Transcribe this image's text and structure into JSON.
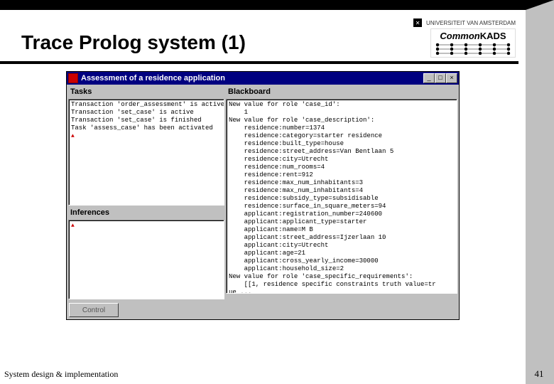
{
  "slide": {
    "title": "Trace Prolog system (1)",
    "footer": "System design & implementation",
    "page_number": "41",
    "inst_logo_text": "UNIVERSITEIT VAN AMSTERDAM",
    "ck_logo_text_1": "Common",
    "ck_logo_text_2": "KADS"
  },
  "window": {
    "title": "Assessment of a residence application",
    "buttons": {
      "min": "_",
      "max": "□",
      "close": "×"
    },
    "labels": {
      "tasks": "Tasks",
      "inferences": "Inferences",
      "blackboard": "Blackboard"
    },
    "tasks_text": "Transaction 'order_assessment' is active\nTransaction 'set_case' is active\nTransaction 'set_case' is finished\nTask 'assess_case' has been activated",
    "blackboard_text": "New value for role 'case_id':\n    1\nNew value for role 'case_description':\n    residence:number=1374\n    residence:category=starter residence\n    residence:built_type=house\n    residence:street_address=Van Bentlaan 5\n    residence:city=Utrecht\n    residence:num_rooms=4\n    residence:rent=912\n    residence:max_num_inhabitants=3\n    residence:max_num_inhabitants=4\n    residence:subsidy_type=subsidisable\n    residence:surface_in_square_meters=94\n    applicant:registration_number=240600\n    applicant:applicant_type=starter\n    applicant:name=M B\n    applicant:street_address=Ijzerlaan 10\n    applicant:city=Utrecht\n    applicant:age=21\n    applicant:cross_yearly_income=30000\n    applicant:household_size=2\nNew value for role 'case_specific_requirements':\n    [[1, residence specific constraints truth value=tr\nue ...",
    "control_button": "Control"
  }
}
